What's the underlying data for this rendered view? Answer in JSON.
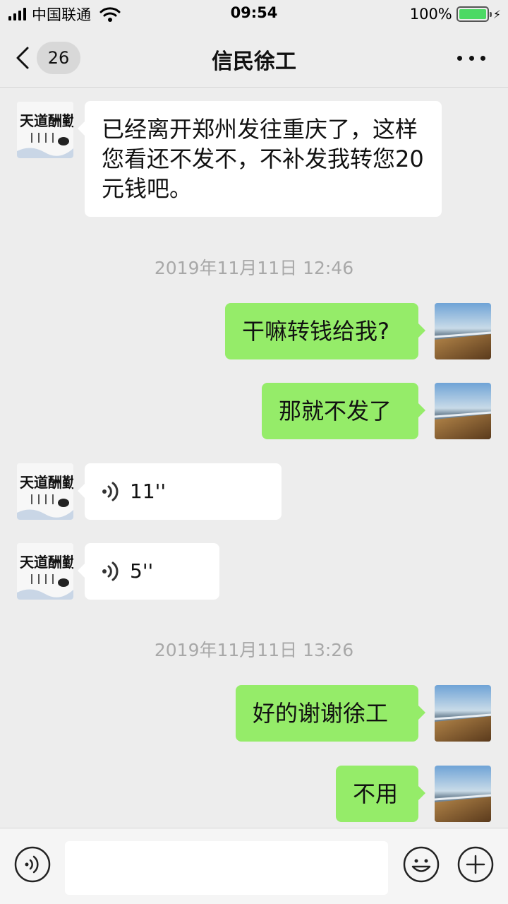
{
  "status_bar": {
    "carrier": "中国联通",
    "time": "09:54",
    "battery": "100%"
  },
  "nav": {
    "unread_count": "26",
    "title": "信民徐工"
  },
  "messages": [
    {
      "side": "in",
      "type": "text",
      "text": "已经离开郑州发往重庆了，这样您看还不发不，不补发我转您20元钱吧。"
    },
    {
      "type": "timestamp",
      "text": "2019年11月11日 12:46"
    },
    {
      "side": "out",
      "type": "text",
      "text": "干嘛转钱给我?"
    },
    {
      "side": "out",
      "type": "text",
      "text": "那就不发了"
    },
    {
      "side": "in",
      "type": "voice",
      "duration": "11''"
    },
    {
      "side": "in",
      "type": "voice",
      "duration": "5''"
    },
    {
      "type": "timestamp",
      "text": "2019年11月11日 13:26"
    },
    {
      "side": "out",
      "type": "text",
      "text": "好的谢谢徐工"
    },
    {
      "side": "out",
      "type": "text",
      "text": "不用"
    }
  ],
  "avatars": {
    "contact_calligraphy": "天道酬勤",
    "contact_icon": "calligraphy-avatar",
    "self_icon": "landscape-avatar"
  },
  "input_bar": {
    "placeholder": "",
    "icons": [
      "voice-mode-icon",
      "emoji-icon",
      "plus-icon"
    ]
  },
  "colors": {
    "background": "#ededed",
    "outgoing_bubble": "#95ec69",
    "incoming_bubble": "#ffffff",
    "battery": "#4cd964"
  }
}
